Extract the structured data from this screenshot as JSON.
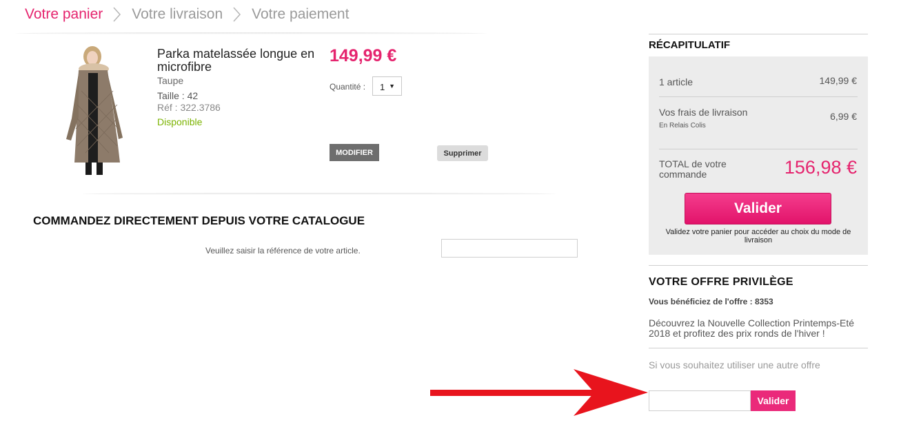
{
  "breadcrumb": {
    "steps": [
      "Votre panier",
      "Votre livraison",
      "Votre paiement"
    ],
    "active_color": "#e5246e",
    "inactive_color": "#9a9a9a"
  },
  "cart": {
    "item": {
      "name": "Parka matelassée longue en microfibre",
      "color": "Taupe",
      "size": "Taille : 42",
      "ref": "Réf : 322.3786",
      "availability": "Disponible",
      "price": "149,99 €",
      "quantity_label": "Quantité :",
      "quantity_value": "1",
      "modify_label": "MODIFIER",
      "delete_label": "Supprimer",
      "image_icon": "parka-photo"
    }
  },
  "catalogue": {
    "title": "COMMANDEZ DIRECTEMENT DEPUIS VOTRE CATALOGUE",
    "label": "Veuillez saisir la référence de votre article.",
    "input_value": ""
  },
  "summary": {
    "title": "RÉCAPITULATIF",
    "articles_label": "1 article",
    "articles_value": "149,99 €",
    "shipping_label": "Vos frais de livraison",
    "shipping_method": "En Relais Colis",
    "shipping_value": "6,99 €",
    "total_label": "TOTAL de votre commande",
    "total_value": "156,98 €",
    "validate_label": "Valider",
    "validate_note": "Validez votre panier pour accéder au choix du mode de livraison"
  },
  "offer": {
    "title": "VOTRE OFFRE PRIVILÈGE",
    "benefit": "Vous bénéficiez de l'offre : 8353",
    "description": "Découvrez la Nouvelle Collection Printemps-Eté 2018 et profitez des prix ronds de l'hiver !",
    "alt_label": "Si vous souhaitez utiliser une autre offre",
    "input_value": "",
    "apply_label": "Valider"
  },
  "colors": {
    "brand_pink": "#e5246e",
    "available_green": "#7bb300",
    "arrow_red": "#e8141d"
  },
  "icons": [
    "chevron-right-icon",
    "dropdown-arrow-icon",
    "red-arrow-annotation"
  ]
}
